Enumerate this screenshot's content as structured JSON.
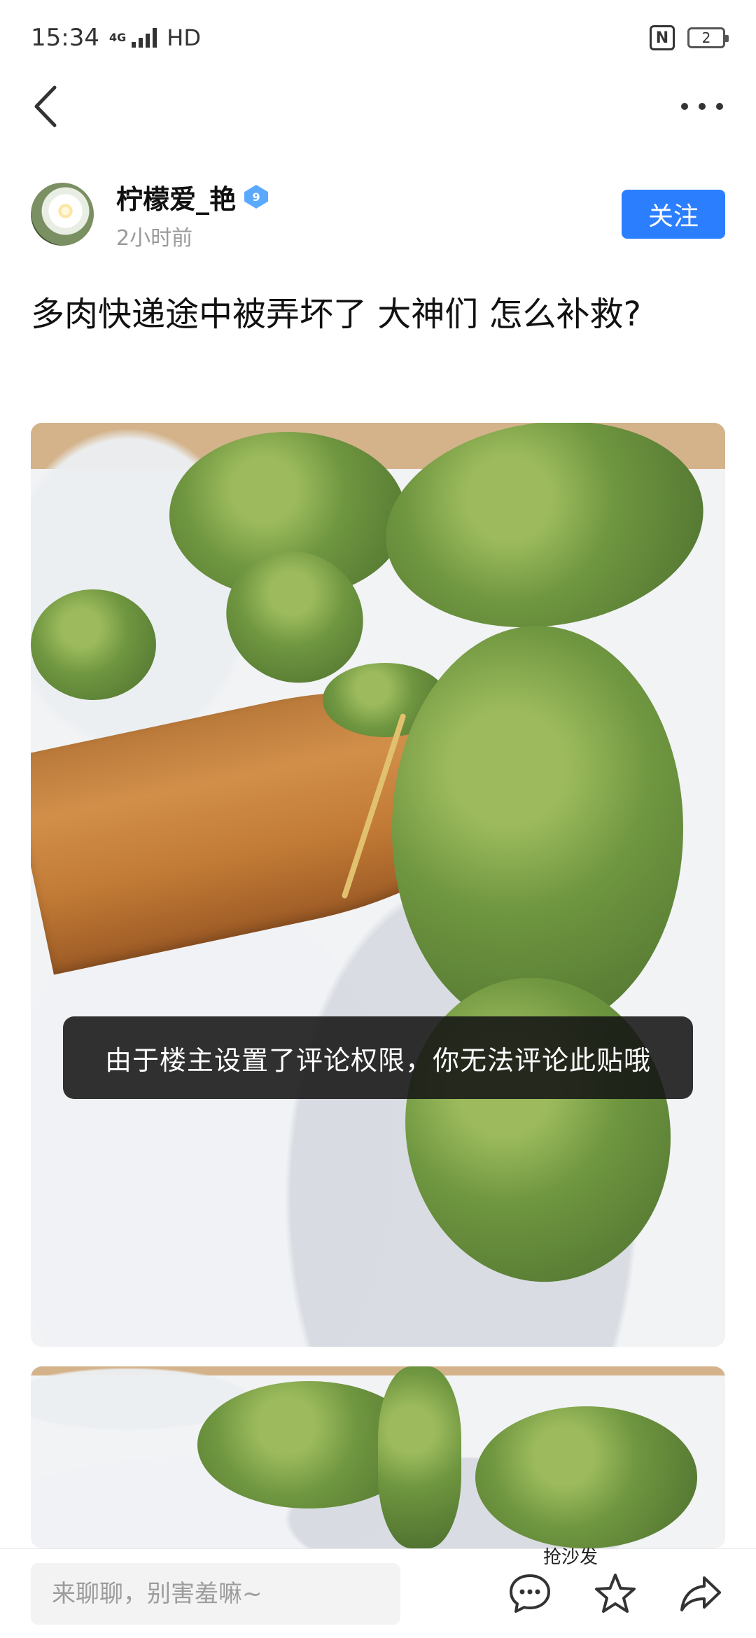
{
  "status_bar": {
    "time": "15:34",
    "network_type": "4G",
    "hd_label": "HD",
    "nfc_label": "N",
    "battery_level": "2"
  },
  "top_nav": {
    "back_icon": "chevron-left-icon",
    "more_icon": "more-horizontal-icon"
  },
  "post": {
    "author": {
      "name": "柠檬爱_艳",
      "level": "9",
      "time": "2小时前"
    },
    "follow_label": "关注",
    "title": "多肉快递途中被弄坏了 大神们 怎么补救?",
    "images": [
      "succulent-photo",
      "succulent-photo"
    ]
  },
  "toast": {
    "message": "由于楼主设置了评论权限，你无法评论此贴哦"
  },
  "bottom_bar": {
    "comment_placeholder": "来聊聊，别害羞嘛~",
    "sofa_label": "抢沙发",
    "icons": {
      "comment": "comment-icon",
      "favorite": "star-icon",
      "share": "share-icon"
    }
  },
  "colors": {
    "accent": "#2b7fff",
    "badge": "#5aa9ff",
    "toast_bg": "#141414",
    "text": "#111111",
    "muted": "#9a9a9a"
  }
}
